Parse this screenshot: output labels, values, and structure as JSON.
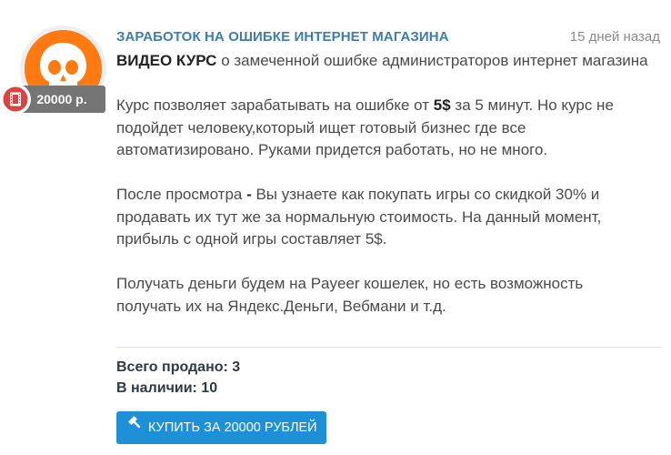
{
  "post": {
    "title": "ЗАРАБОТОК НА ОШИБКЕ ИНТЕРНЕТ МАГАЗИНА",
    "time": "15 дней назад",
    "price_badge": "20000 р.",
    "category_icon": "film-icon",
    "avatar_icon": "skull-icon",
    "lead_bold": "ВИДЕО КУРС",
    "lead_rest": " о замеченной ошибке администраторов интернет магазина",
    "para1_a": "Курс позволяет зарабатывать на ошибке от ",
    "para1_bold": "5$",
    "para1_b": " за 5 минут. Но курс не подойдет человеку,который ищет готовый бизнес где все автоматизировано. Руками придется работать, но не много.",
    "para2_a": "После просмотра ",
    "para2_bold": "-",
    "para2_b": " Вы узнаете как покупать игры со скидкой 30% и продавать их тут же за нормальную стоимость. На данный момент, прибыль с одной игры составляет 5$.",
    "para3": "Получать деньги будем на Payeer кошелек, но есть возможность получать их на Яндекс.Деньги, Вебмани и т.д."
  },
  "stats": {
    "sold": "Всего продано: 3",
    "in_stock": "В наличии: 10"
  },
  "buy_button": {
    "label": "КУПИТЬ ЗА 20000 РУБЛЕЙ",
    "icon": "hammer-icon"
  },
  "colors": {
    "title": "#3f7ca6",
    "avatar_bg": "#ff7a12",
    "button_bg": "#1e90d8",
    "badge_bg": "#757575",
    "film_icon": "#d64541"
  }
}
